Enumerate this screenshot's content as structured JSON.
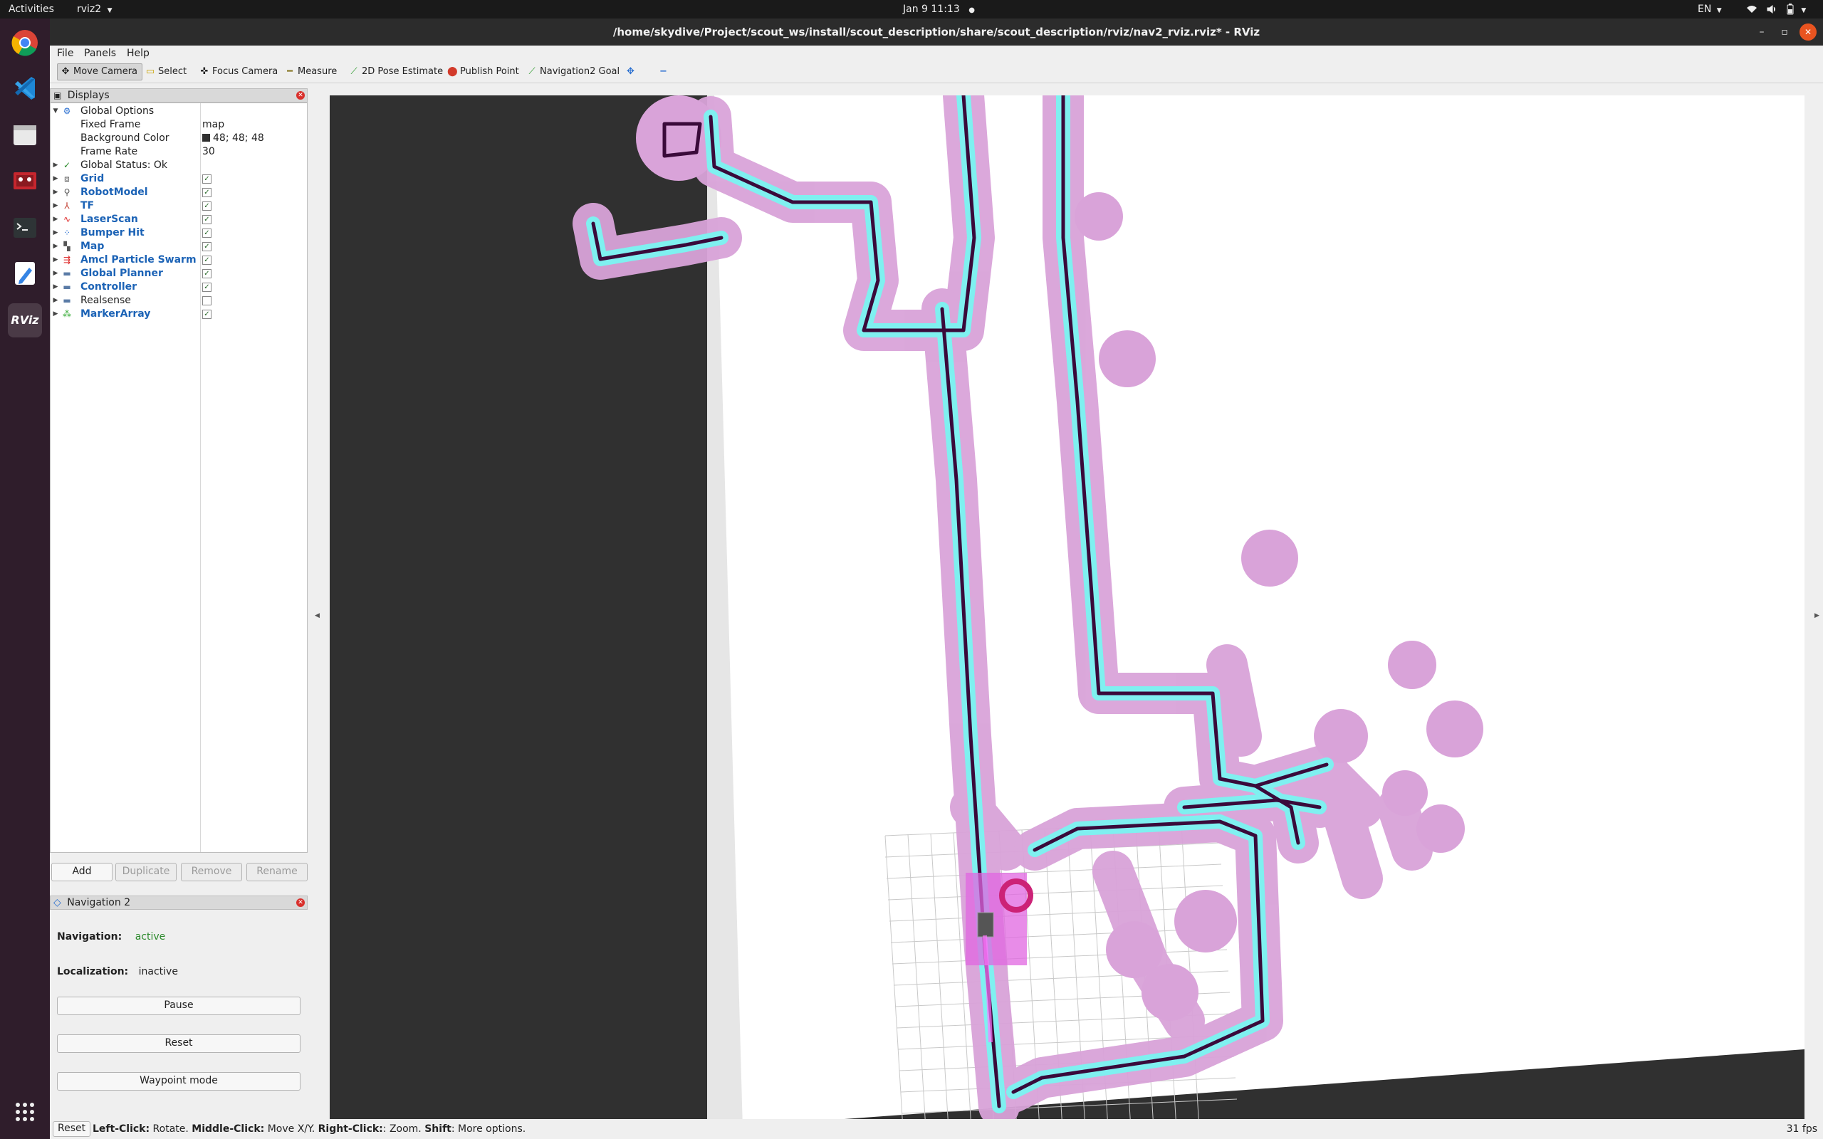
{
  "topbar": {
    "activities": "Activities",
    "app_menu": "rviz2",
    "clock": "Jan 9  11:13",
    "language": "EN"
  },
  "dock": {
    "items": [
      "chrome-icon",
      "vscode-icon",
      "files-icon",
      "presentation-icon",
      "terminal-icon",
      "text-editor-icon",
      "rviz-icon"
    ],
    "active": "rviz-icon",
    "grid": "show-apps-icon",
    "rviz_label": "RViz"
  },
  "window": {
    "title": "/home/skydive/Project/scout_ws/install/scout_description/share/scout_description/rviz/nav2_rviz.rviz* - RViz",
    "minimize": "–",
    "maximize": "▫",
    "close": "✕"
  },
  "menu": {
    "file": "File",
    "panels": "Panels",
    "help": "Help"
  },
  "toolbar": {
    "move_camera": "Move Camera",
    "select": "Select",
    "focus_camera": "Focus Camera",
    "measure": "Measure",
    "pose_estimate": "2D Pose Estimate",
    "publish_point": "Publish Point",
    "nav2_goal": "Navigation2 Goal",
    "add_tool": "✥",
    "remove_tool": "−"
  },
  "displays": {
    "title": "Displays",
    "global_options": "Global Options",
    "fixed_frame_label": "Fixed Frame",
    "fixed_frame_value": "map",
    "bg_label": "Background Color",
    "bg_value": "48; 48; 48",
    "frame_rate_label": "Frame Rate",
    "frame_rate_value": "30",
    "global_status": "Global Status: Ok",
    "items": [
      {
        "label": "Grid",
        "checked": true
      },
      {
        "label": "RobotModel",
        "checked": true
      },
      {
        "label": "TF",
        "checked": true
      },
      {
        "label": "LaserScan",
        "checked": true
      },
      {
        "label": "Bumper Hit",
        "checked": true
      },
      {
        "label": "Map",
        "checked": true
      },
      {
        "label": "Amcl Particle Swarm",
        "checked": true
      },
      {
        "label": "Global Planner",
        "checked": true
      },
      {
        "label": "Controller",
        "checked": true
      },
      {
        "label": "Realsense",
        "checked": false
      },
      {
        "label": "MarkerArray",
        "checked": true
      }
    ],
    "buttons": {
      "add": "Add",
      "duplicate": "Duplicate",
      "remove": "Remove",
      "rename": "Rename"
    }
  },
  "nav2": {
    "title": "Navigation 2",
    "navigation_label": "Navigation:",
    "navigation_value": "active",
    "localization_label": "Localization:",
    "localization_value": "inactive",
    "pause": "Pause",
    "reset": "Reset",
    "waypoint": "Waypoint mode"
  },
  "status": {
    "reset": "Reset",
    "hint_parts": [
      "Left-Click:",
      " Rotate. ",
      "Middle-Click:",
      " Move X/Y. ",
      "Right-Click:",
      ": Zoom. ",
      "Shift",
      ": More options."
    ],
    "fps": "31 fps"
  },
  "colors": {
    "background": "#303030",
    "map_free": "#ffffff",
    "obstacle": "#3a0a3a",
    "inflation_inner": "#7ff0f0",
    "inflation_outer": "#d9a3d9",
    "active_green": "#2e8b2e"
  }
}
